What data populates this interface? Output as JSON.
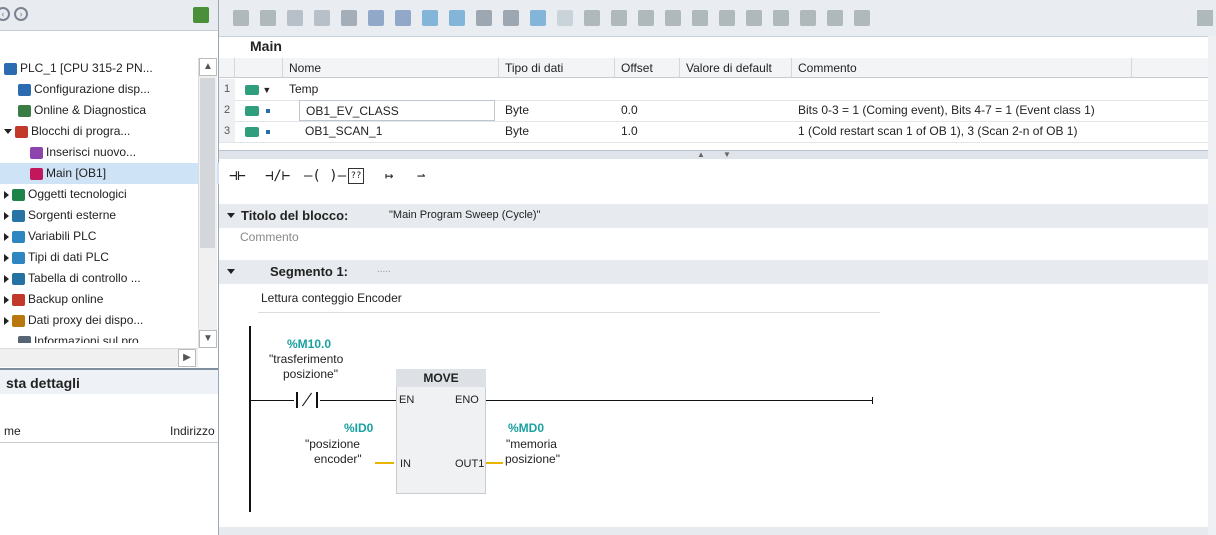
{
  "left_panel": {
    "tree": [
      {
        "label": "PLC_1 [CPU 315-2 PN...",
        "icon": "plc-icon",
        "indent": 0
      },
      {
        "label": "Configurazione disp...",
        "icon": "device-config-icon",
        "indent": 1
      },
      {
        "label": "Online & Diagnostica",
        "icon": "diagnostics-icon",
        "indent": 1
      },
      {
        "label": "Blocchi di progra...",
        "icon": "program-blocks-icon",
        "indent": 0
      },
      {
        "label": "Inserisci nuovo...",
        "icon": "add-new-icon",
        "indent": 2
      },
      {
        "label": "Main [OB1]",
        "icon": "ob-block-icon",
        "indent": 2
      },
      {
        "label": "Oggetti tecnologici",
        "icon": "tech-objects-icon",
        "indent": 0
      },
      {
        "label": "Sorgenti esterne",
        "icon": "external-sources-icon",
        "indent": 0
      },
      {
        "label": "Variabili PLC",
        "icon": "plc-tags-icon",
        "indent": 0
      },
      {
        "label": "Tipi di dati PLC",
        "icon": "plc-data-types-icon",
        "indent": 0
      },
      {
        "label": "Tabella di controllo ...",
        "icon": "watch-table-icon",
        "indent": 0
      },
      {
        "label": "Backup online",
        "icon": "backup-icon",
        "indent": 0
      },
      {
        "label": "Dati proxy dei dispo...",
        "icon": "proxy-data-icon",
        "indent": 0
      },
      {
        "label": "Informazioni sul pro...",
        "icon": "info-icon",
        "indent": 1
      }
    ],
    "details_title": "sta dettagli",
    "details_columns": [
      "me",
      "Indirizzo"
    ]
  },
  "editor": {
    "block_name": "Main",
    "interface_columns": [
      "Nome",
      "Tipo di dati",
      "Offset",
      "Valore di default",
      "Commento"
    ],
    "interface_rows": [
      {
        "num": "1",
        "name": "Temp",
        "type": "",
        "offset": "",
        "default": "",
        "comment": ""
      },
      {
        "num": "2",
        "name": "OB1_EV_CLASS",
        "type": "Byte",
        "offset": "0.0",
        "default": "",
        "comment": "Bits 0-3 = 1 (Coming event), Bits 4-7 = 1 (Event class 1)"
      },
      {
        "num": "3",
        "name": "OB1_SCAN_1",
        "type": "Byte",
        "offset": "1.0",
        "default": "",
        "comment": "1 (Cold restart scan 1 of OB 1), 3 (Scan 2-n of OB 1)"
      }
    ],
    "block_title_label": "Titolo del blocco:",
    "block_title_value": "\"Main Program Sweep (Cycle)\"",
    "block_comment_placeholder": "Commento",
    "segment_label": "Segmento 1:",
    "segment_title_placeholder": ".....",
    "segment_comment": "Lettura conteggio Encoder",
    "network": {
      "contact_address": "%M10.0",
      "contact_name_line1": "\"trasferimento",
      "contact_name_line2": "posizione\"",
      "box_title": "MOVE",
      "pin_en": "EN",
      "pin_eno": "ENO",
      "pin_in": "IN",
      "pin_out": "OUT1",
      "in_address": "%ID0",
      "in_name_line1": "\"posizione",
      "in_name_line2": "encoder\"",
      "out_address": "%MD0",
      "out_name_line1": "\"memoria",
      "out_name_line2": "posizione\""
    }
  },
  "colors": {
    "address_teal": "#1aa0a0",
    "selection_blue": "#cfe3f6",
    "header_gray": "#e7eaee"
  }
}
